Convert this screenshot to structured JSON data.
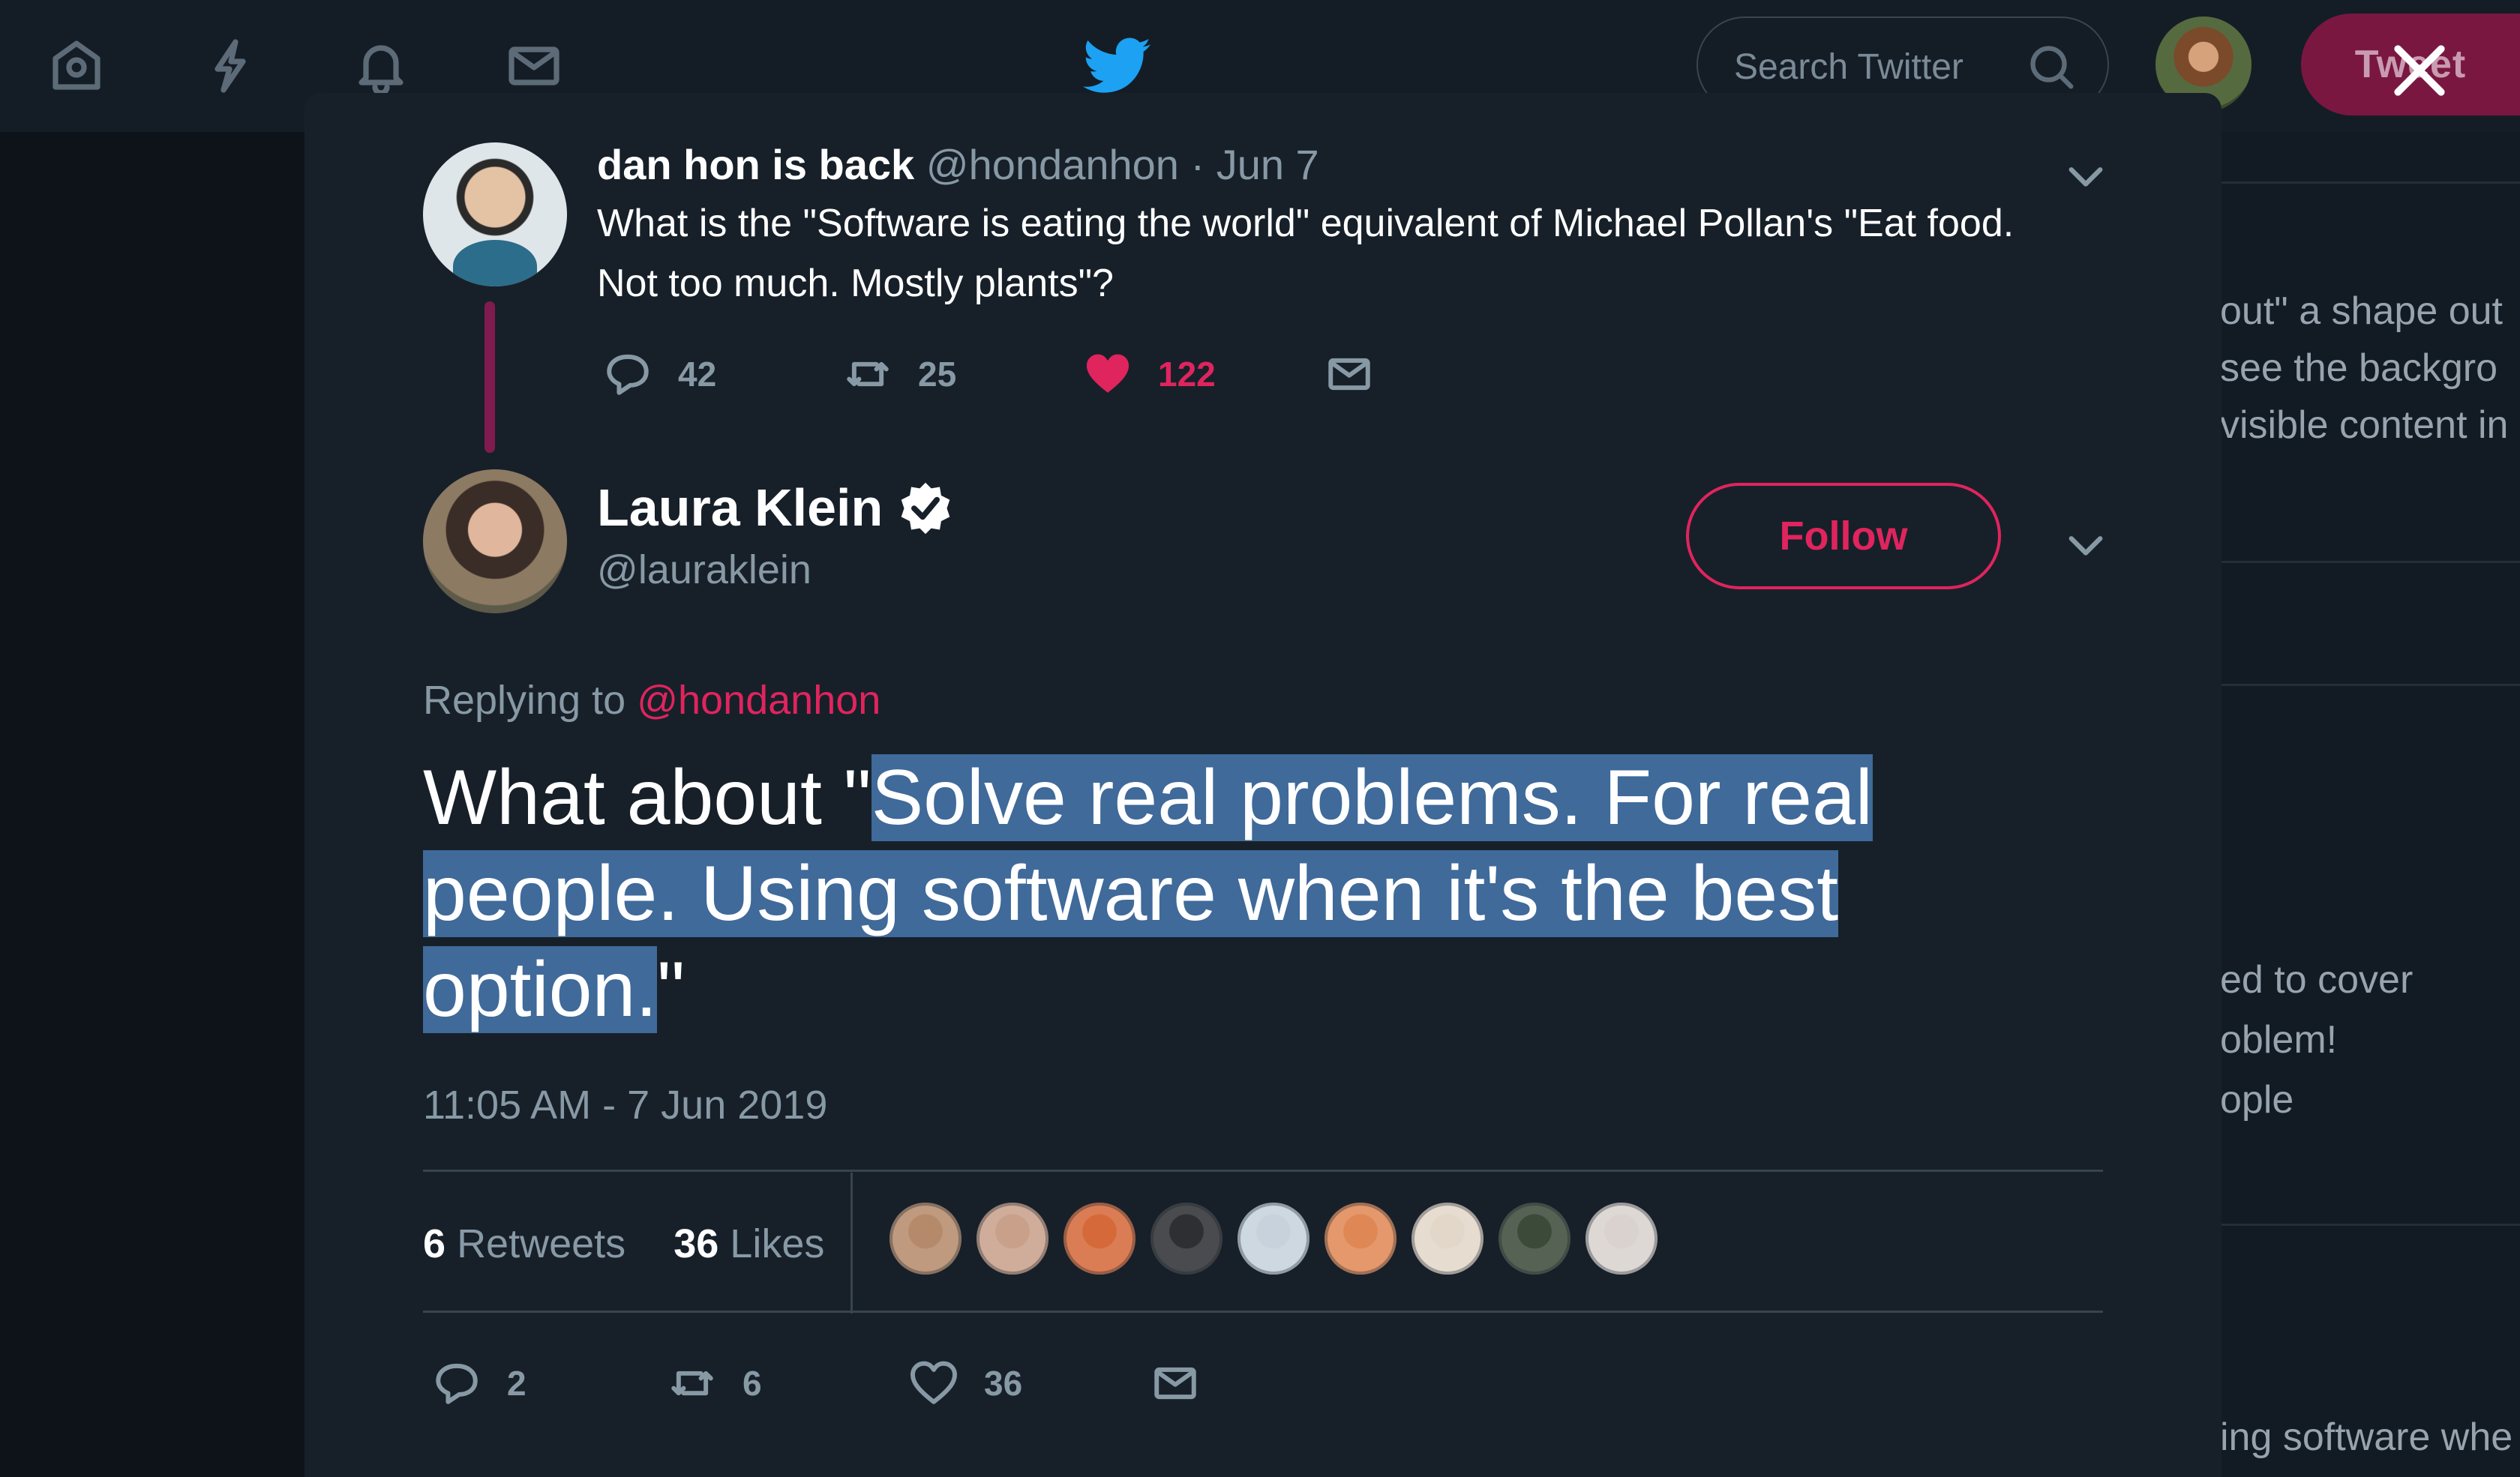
{
  "topbar": {
    "nav_icons": [
      "home-icon",
      "moments-icon",
      "notifications-icon",
      "messages-icon"
    ],
    "logo": "twitter-bird-icon",
    "search": {
      "placeholder": "Search Twitter"
    },
    "tweet_button_label": "Tweet"
  },
  "background_column": {
    "lines": [
      "out\" a shape out",
      "see the backgro",
      "visible content in",
      "ed to cover",
      "oblem!",
      "ople",
      "ing software whe"
    ]
  },
  "parent_tweet": {
    "display_name": "dan hon is back",
    "handle": "@hondanhon",
    "date": "· Jun 7",
    "text": "What is the \"Software is eating the world\" equivalent of Michael Pollan's \"Eat food. Not too much. Mostly plants\"?",
    "replies": "42",
    "retweets": "25",
    "likes": "122"
  },
  "main_tweet": {
    "display_name": "Laura Klein",
    "handle": "@lauraklein",
    "follow_label": "Follow",
    "replying_prefix": "Replying to",
    "replying_mention": "@hondanhon",
    "text_before": "What about \"",
    "text_selected": "Solve real problems. For real people. Using software when it's the best option.",
    "text_after": "\"",
    "timestamp": "11:05 AM - 7 Jun 2019",
    "retweet_count": "6",
    "retweet_word": "Retweets",
    "like_count": "36",
    "like_word": "Likes",
    "likers": [
      "#b58a6a",
      "#c9a08a",
      "#d6693a",
      "#2d2f33",
      "#c7d2dc",
      "#e08855",
      "#e2d7c8",
      "#3c4a3a",
      "#d9d2cf"
    ],
    "replies": "2",
    "retweets": "6",
    "likes": "36"
  },
  "colors": {
    "accent_pink": "#e0245e",
    "selection": "#3f6a9a",
    "muted": "#8899a6",
    "twitter_blue": "#1da1f2"
  }
}
